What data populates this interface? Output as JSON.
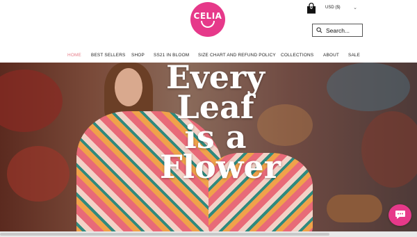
{
  "brand": {
    "logo_text": "CELIA"
  },
  "header": {
    "cart_count": "0",
    "currency": "USD ($)",
    "search_placeholder": "Search..."
  },
  "nav": {
    "items": [
      {
        "label": "HOME",
        "active": true
      },
      {
        "label": "BEST SELLERS"
      },
      {
        "label": "SHOP"
      },
      {
        "label": "SS21 IN BLOOM"
      },
      {
        "label": "SIZE CHART AND REFUND POLICY"
      },
      {
        "label": "COLLECTIONS"
      },
      {
        "label": "ABOUT"
      },
      {
        "label": "SALE"
      }
    ]
  },
  "hero": {
    "headline_lines": [
      "Every",
      "Leaf",
      "is a",
      "Flower"
    ]
  },
  "colors": {
    "brand_pink": "#e6398a",
    "nav_active": "#e67a86"
  },
  "icons": [
    "cart-icon",
    "chevron-down-icon",
    "search-icon",
    "chat-icon"
  ]
}
